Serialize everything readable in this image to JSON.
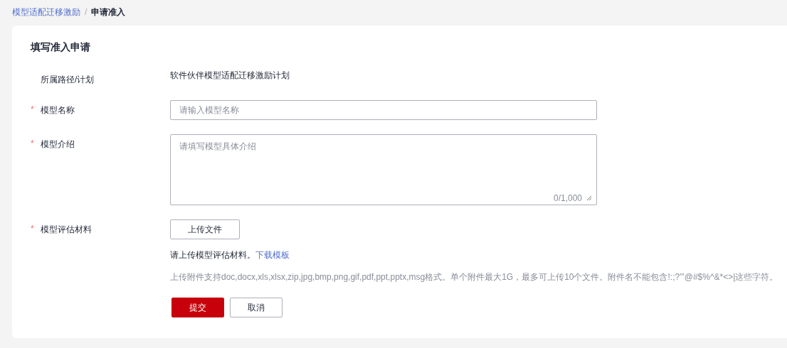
{
  "breadcrumb": [
    {
      "label": "模型适配迁移激励",
      "current": false
    },
    {
      "label": "申请准入",
      "current": true
    }
  ],
  "breadcrumb_separator": "/",
  "form": {
    "title": "填写准入申请",
    "fields": [
      {
        "kind": "text",
        "label": "所属路径/计划",
        "required": false,
        "value": "软件伙伴模型适配迁移激励计划"
      },
      {
        "kind": "input",
        "label": "模型名称",
        "required": true,
        "placeholder": "请输入模型名称"
      },
      {
        "kind": "textarea",
        "label": "模型介绍",
        "required": true,
        "placeholder": "请填写模型具体介绍",
        "counter": "0/1,000"
      },
      {
        "kind": "upload",
        "label": "模型评估材料",
        "required": true,
        "button": "上传文件",
        "hint": "请上传模型评估材料。",
        "link": "下载模板",
        "note": "上传附件支持doc,docx,xls,xlsx,zip,jpg,bmp,png,gif,pdf,ppt,pptx,msg格式。单个附件最大1G，最多可上传10个文件。附件名不能包含!:;?\"'@#$%^&*<>|这些字符。"
      }
    ],
    "required_mark": "*",
    "buttons": [
      {
        "label": "提交",
        "primary": true
      },
      {
        "label": "取消",
        "primary": false
      }
    ]
  }
}
